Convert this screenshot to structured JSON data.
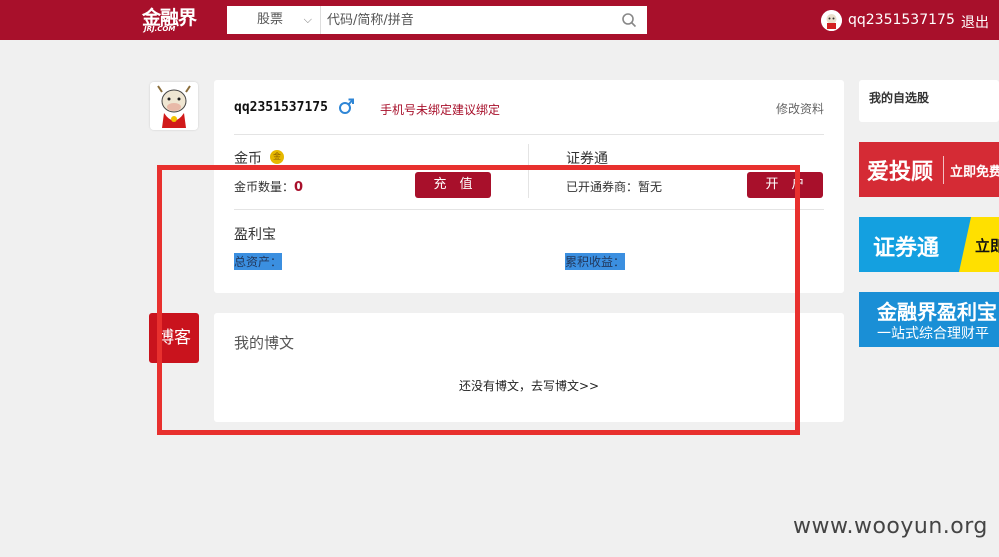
{
  "header": {
    "logo_text": "金融界",
    "logo_sub": "JRJ.COM",
    "search": {
      "category": "股票",
      "placeholder": "代码/简称/拼音"
    },
    "username": "qq2351537175",
    "logout_label": "退出"
  },
  "profile": {
    "username": "qq2351537175",
    "phone_hint": "手机号未绑定建议绑定",
    "edit_label": "修改资料",
    "coins": {
      "title": "金币",
      "count_label": "金币数量：",
      "count_value": "0",
      "recharge_label": "充　值"
    },
    "securities": {
      "title": "证券通",
      "broker_label": "已开通券商：暂无",
      "open_label": "开　户"
    },
    "yinglibao": {
      "title": "盈利宝",
      "total_assets_label": "总资产：",
      "cumulative_income_label": "累积收益："
    }
  },
  "blog": {
    "tab_label": "博客",
    "title": "我的博文",
    "empty_text": "还没有博文，去写博文>>"
  },
  "sidebar": {
    "watchlist_title": "我的自选股",
    "ads": [
      {
        "main": "爱投顾",
        "sub": "立即免费"
      },
      {
        "main": "证券通",
        "sub": "立即"
      },
      {
        "main": "金融界盈利宝",
        "sub": "一站式综合理财平"
      }
    ]
  },
  "watermark": "www.wooyun.org",
  "colors": {
    "brand_red": "#a8102b",
    "annotation_red": "#e8302e",
    "highlight_blue": "#3b8fe0"
  }
}
